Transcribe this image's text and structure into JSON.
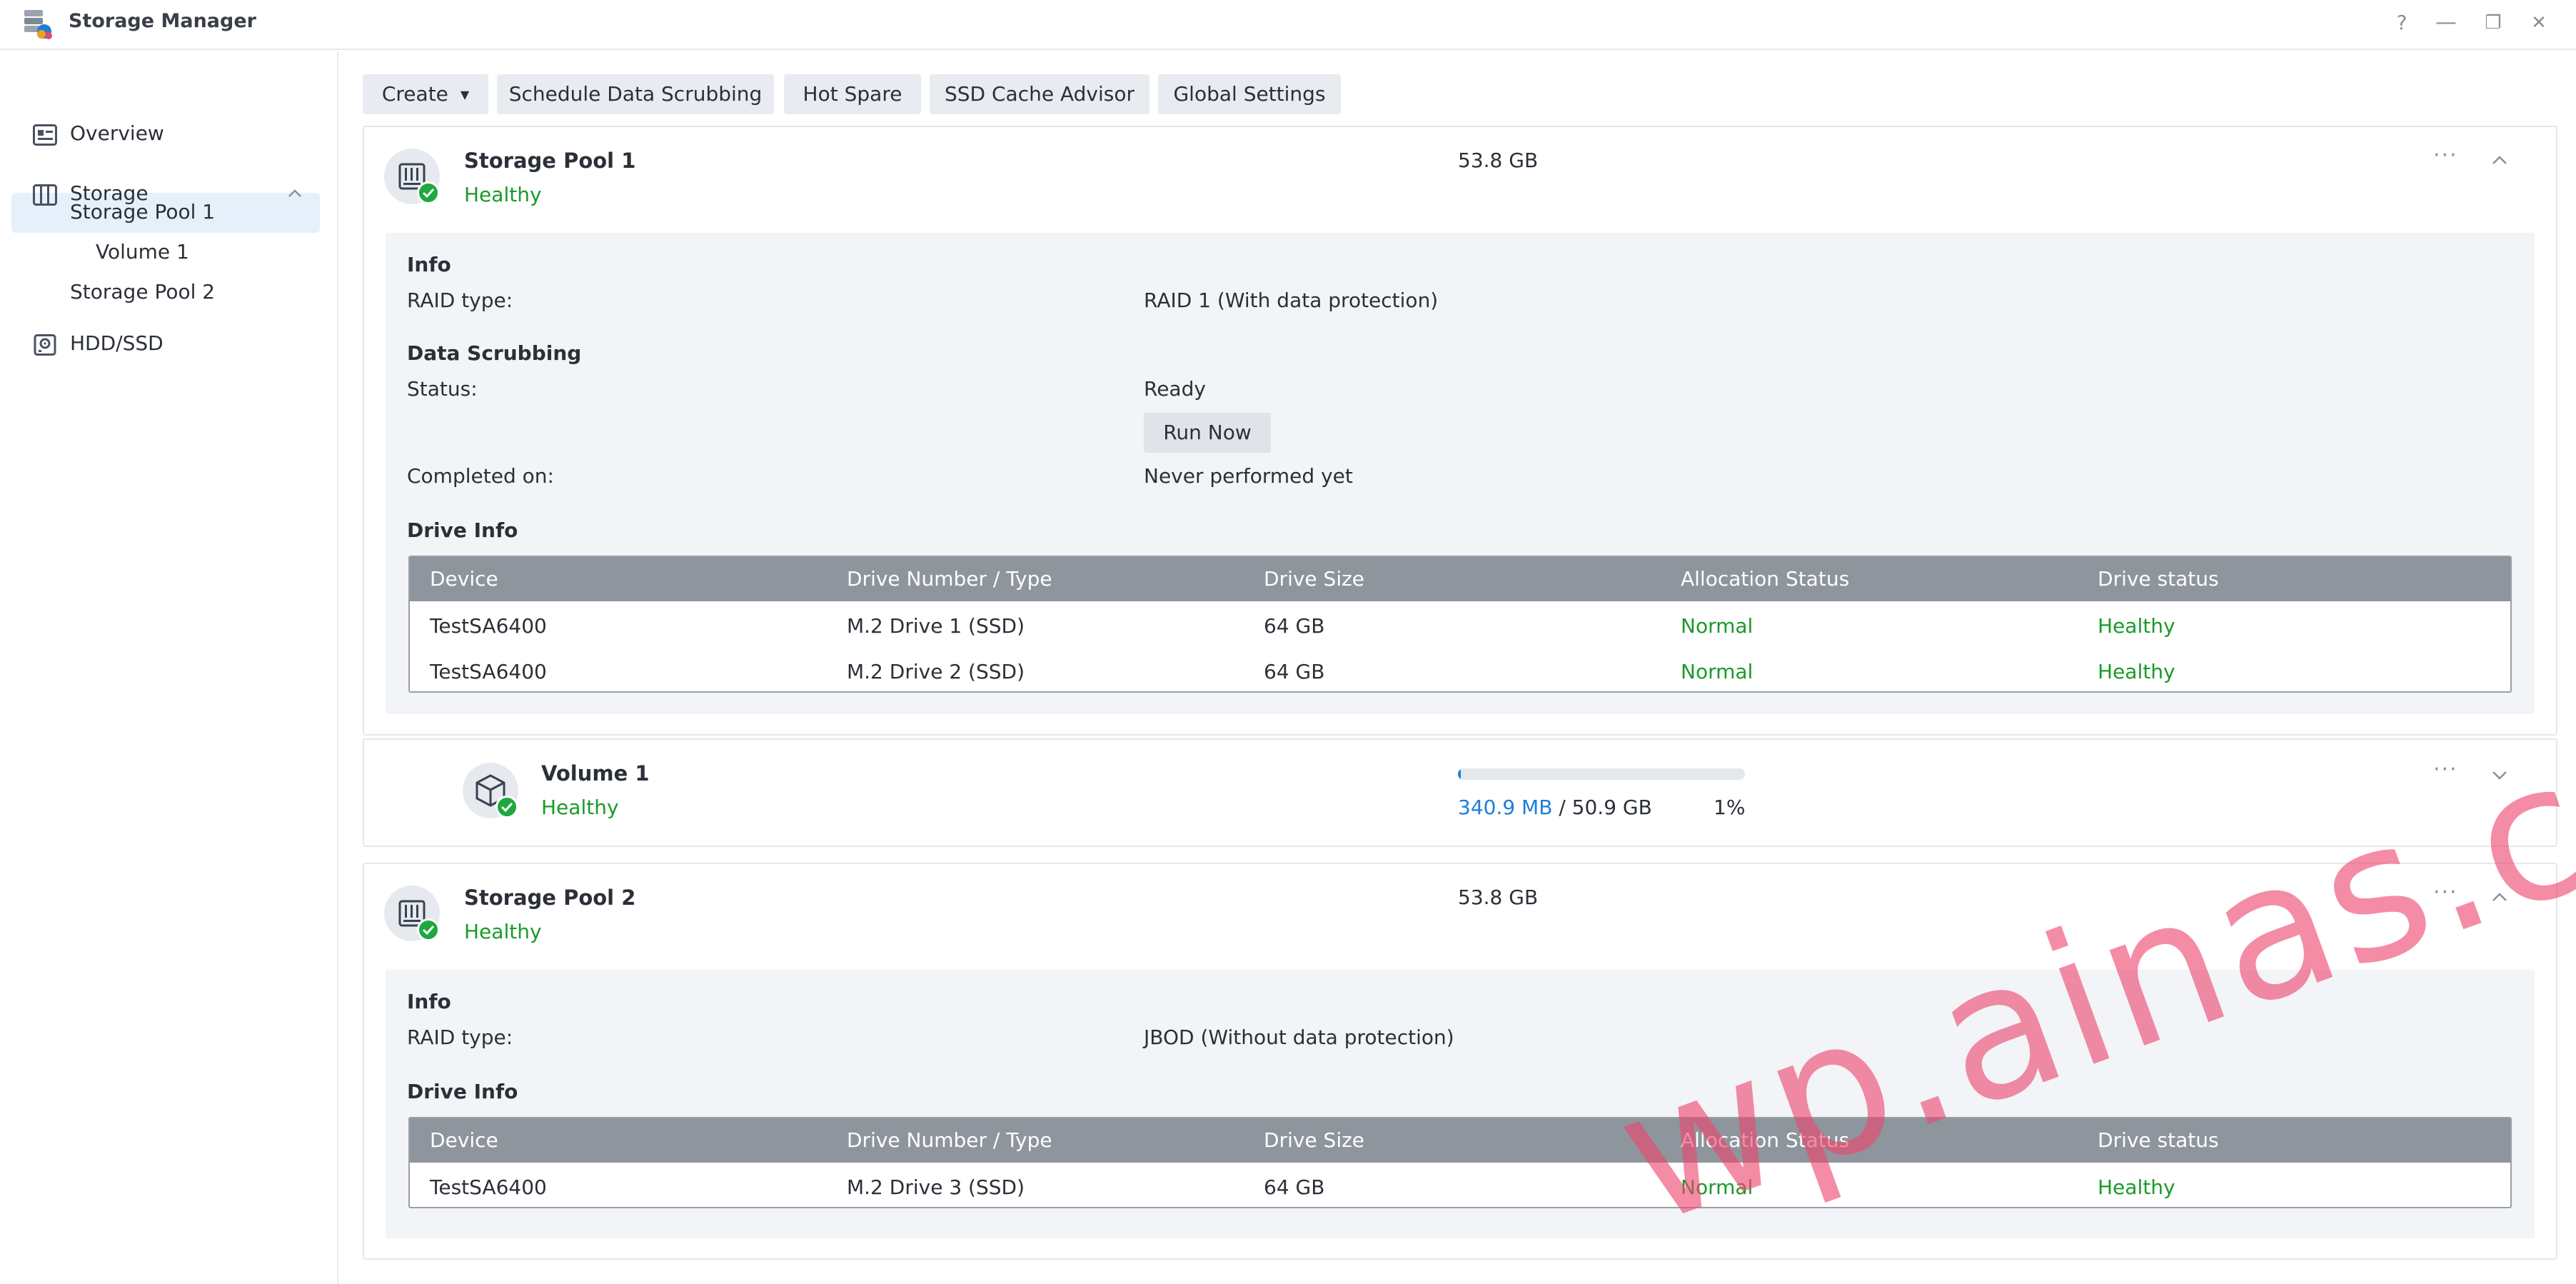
{
  "window": {
    "title": "Storage Manager",
    "controls": {
      "help": "?",
      "minimize": "—",
      "restore": "❐",
      "close": "✕"
    }
  },
  "sidebar": {
    "items": [
      {
        "label": "Overview",
        "icon": "overview-icon"
      },
      {
        "label": "Storage",
        "icon": "storage-icon",
        "expanded": true
      },
      {
        "label": "Storage Pool 1",
        "selected": true
      },
      {
        "label": "Volume 1"
      },
      {
        "label": "Storage Pool 2"
      },
      {
        "label": "HDD/SSD",
        "icon": "hdd-icon"
      }
    ]
  },
  "toolbar": {
    "create": "Create",
    "schedule": "Schedule Data Scrubbing",
    "hot_spare": "Hot Spare",
    "ssd_cache": "SSD Cache Advisor",
    "global": "Global Settings"
  },
  "pool1": {
    "name": "Storage Pool 1",
    "status": "Healthy",
    "size": "53.8 GB",
    "info_heading": "Info",
    "raid_label": "RAID type:",
    "raid_value": "RAID 1 (With data protection)",
    "scrub_heading": "Data Scrubbing",
    "status_label": "Status:",
    "status_value": "Ready",
    "run_now": "Run Now",
    "completed_label": "Completed on:",
    "completed_value": "Never performed yet",
    "drive_heading": "Drive Info",
    "columns": [
      "Device",
      "Drive Number / Type",
      "Drive Size",
      "Allocation Status",
      "Drive status"
    ],
    "drives": [
      {
        "device": "TestSA6400",
        "number": "M.2 Drive 1 (SSD)",
        "size": "64 GB",
        "allocation": "Normal",
        "status": "Healthy"
      },
      {
        "device": "TestSA6400",
        "number": "M.2 Drive 2 (SSD)",
        "size": "64 GB",
        "allocation": "Normal",
        "status": "Healthy"
      }
    ]
  },
  "volume1": {
    "name": "Volume 1",
    "status": "Healthy",
    "used": "340.9 MB",
    "separator": " / ",
    "total": "50.9 GB",
    "percent": "1%",
    "usage_fraction": 0.01
  },
  "pool2": {
    "name": "Storage Pool 2",
    "status": "Healthy",
    "size": "53.8 GB",
    "info_heading": "Info",
    "raid_label": "RAID type:",
    "raid_value": "JBOD (Without data protection)",
    "drive_heading": "Drive Info",
    "columns": [
      "Device",
      "Drive Number / Type",
      "Drive Size",
      "Allocation Status",
      "Drive status"
    ],
    "drives": [
      {
        "device": "TestSA6400",
        "number": "M.2 Drive 3 (SSD)",
        "size": "64 GB",
        "allocation": "Normal",
        "status": "Healthy"
      }
    ]
  },
  "watermark": "wp.ainas.cc",
  "colors": {
    "healthy": "#1a9a2a",
    "accent": "#1e7ed6",
    "table_header": "#8f959d"
  }
}
